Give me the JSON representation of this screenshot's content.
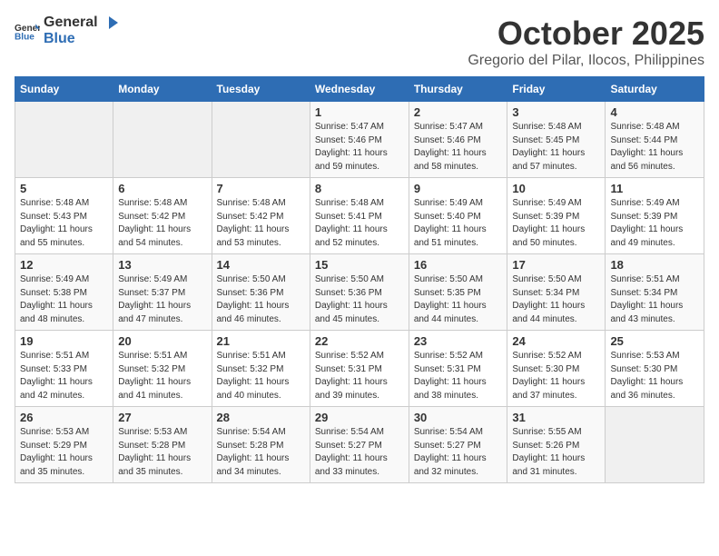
{
  "logo": {
    "general": "General",
    "blue": "Blue"
  },
  "header": {
    "title": "October 2025",
    "subtitle": "Gregorio del Pilar, Ilocos, Philippines"
  },
  "weekdays": [
    "Sunday",
    "Monday",
    "Tuesday",
    "Wednesday",
    "Thursday",
    "Friday",
    "Saturday"
  ],
  "weeks": [
    [
      {
        "day": "",
        "info": ""
      },
      {
        "day": "",
        "info": ""
      },
      {
        "day": "",
        "info": ""
      },
      {
        "day": "1",
        "info": "Sunrise: 5:47 AM\nSunset: 5:46 PM\nDaylight: 11 hours and 59 minutes."
      },
      {
        "day": "2",
        "info": "Sunrise: 5:47 AM\nSunset: 5:46 PM\nDaylight: 11 hours and 58 minutes."
      },
      {
        "day": "3",
        "info": "Sunrise: 5:48 AM\nSunset: 5:45 PM\nDaylight: 11 hours and 57 minutes."
      },
      {
        "day": "4",
        "info": "Sunrise: 5:48 AM\nSunset: 5:44 PM\nDaylight: 11 hours and 56 minutes."
      }
    ],
    [
      {
        "day": "5",
        "info": "Sunrise: 5:48 AM\nSunset: 5:43 PM\nDaylight: 11 hours and 55 minutes."
      },
      {
        "day": "6",
        "info": "Sunrise: 5:48 AM\nSunset: 5:42 PM\nDaylight: 11 hours and 54 minutes."
      },
      {
        "day": "7",
        "info": "Sunrise: 5:48 AM\nSunset: 5:42 PM\nDaylight: 11 hours and 53 minutes."
      },
      {
        "day": "8",
        "info": "Sunrise: 5:48 AM\nSunset: 5:41 PM\nDaylight: 11 hours and 52 minutes."
      },
      {
        "day": "9",
        "info": "Sunrise: 5:49 AM\nSunset: 5:40 PM\nDaylight: 11 hours and 51 minutes."
      },
      {
        "day": "10",
        "info": "Sunrise: 5:49 AM\nSunset: 5:39 PM\nDaylight: 11 hours and 50 minutes."
      },
      {
        "day": "11",
        "info": "Sunrise: 5:49 AM\nSunset: 5:39 PM\nDaylight: 11 hours and 49 minutes."
      }
    ],
    [
      {
        "day": "12",
        "info": "Sunrise: 5:49 AM\nSunset: 5:38 PM\nDaylight: 11 hours and 48 minutes."
      },
      {
        "day": "13",
        "info": "Sunrise: 5:49 AM\nSunset: 5:37 PM\nDaylight: 11 hours and 47 minutes."
      },
      {
        "day": "14",
        "info": "Sunrise: 5:50 AM\nSunset: 5:36 PM\nDaylight: 11 hours and 46 minutes."
      },
      {
        "day": "15",
        "info": "Sunrise: 5:50 AM\nSunset: 5:36 PM\nDaylight: 11 hours and 45 minutes."
      },
      {
        "day": "16",
        "info": "Sunrise: 5:50 AM\nSunset: 5:35 PM\nDaylight: 11 hours and 44 minutes."
      },
      {
        "day": "17",
        "info": "Sunrise: 5:50 AM\nSunset: 5:34 PM\nDaylight: 11 hours and 44 minutes."
      },
      {
        "day": "18",
        "info": "Sunrise: 5:51 AM\nSunset: 5:34 PM\nDaylight: 11 hours and 43 minutes."
      }
    ],
    [
      {
        "day": "19",
        "info": "Sunrise: 5:51 AM\nSunset: 5:33 PM\nDaylight: 11 hours and 42 minutes."
      },
      {
        "day": "20",
        "info": "Sunrise: 5:51 AM\nSunset: 5:32 PM\nDaylight: 11 hours and 41 minutes."
      },
      {
        "day": "21",
        "info": "Sunrise: 5:51 AM\nSunset: 5:32 PM\nDaylight: 11 hours and 40 minutes."
      },
      {
        "day": "22",
        "info": "Sunrise: 5:52 AM\nSunset: 5:31 PM\nDaylight: 11 hours and 39 minutes."
      },
      {
        "day": "23",
        "info": "Sunrise: 5:52 AM\nSunset: 5:31 PM\nDaylight: 11 hours and 38 minutes."
      },
      {
        "day": "24",
        "info": "Sunrise: 5:52 AM\nSunset: 5:30 PM\nDaylight: 11 hours and 37 minutes."
      },
      {
        "day": "25",
        "info": "Sunrise: 5:53 AM\nSunset: 5:30 PM\nDaylight: 11 hours and 36 minutes."
      }
    ],
    [
      {
        "day": "26",
        "info": "Sunrise: 5:53 AM\nSunset: 5:29 PM\nDaylight: 11 hours and 35 minutes."
      },
      {
        "day": "27",
        "info": "Sunrise: 5:53 AM\nSunset: 5:28 PM\nDaylight: 11 hours and 35 minutes."
      },
      {
        "day": "28",
        "info": "Sunrise: 5:54 AM\nSunset: 5:28 PM\nDaylight: 11 hours and 34 minutes."
      },
      {
        "day": "29",
        "info": "Sunrise: 5:54 AM\nSunset: 5:27 PM\nDaylight: 11 hours and 33 minutes."
      },
      {
        "day": "30",
        "info": "Sunrise: 5:54 AM\nSunset: 5:27 PM\nDaylight: 11 hours and 32 minutes."
      },
      {
        "day": "31",
        "info": "Sunrise: 5:55 AM\nSunset: 5:26 PM\nDaylight: 11 hours and 31 minutes."
      },
      {
        "day": "",
        "info": ""
      }
    ]
  ]
}
